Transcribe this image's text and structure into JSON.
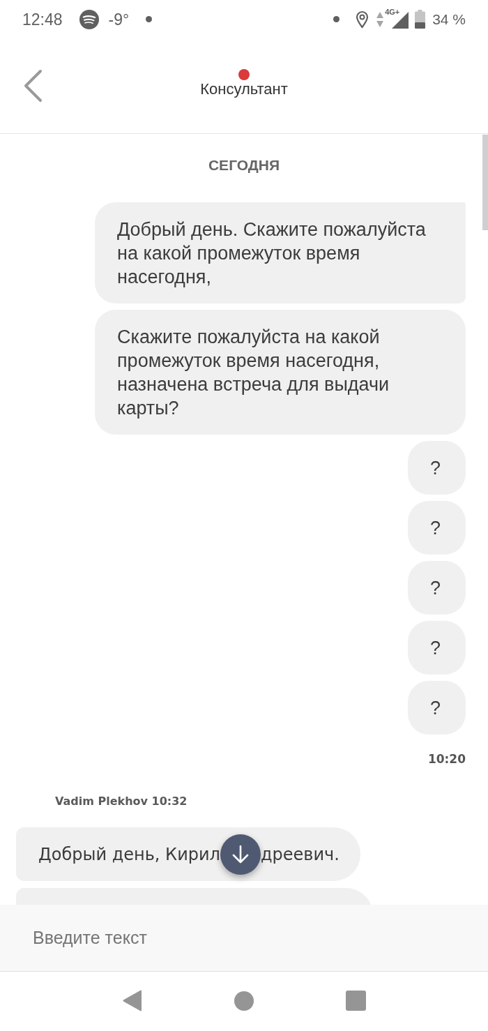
{
  "status_bar": {
    "time": "12:48",
    "temperature": "-9°",
    "network": "4G+",
    "battery": "34 %"
  },
  "header": {
    "title": "Консультант"
  },
  "chat": {
    "date_divider": "СЕГОДНЯ",
    "groups": [
      {
        "kind": "outgoing",
        "messages": [
          {
            "kind": "text",
            "text": "Добрый день. Скажите пожалуйста на какой промежуток время насегодня,"
          },
          {
            "kind": "text",
            "text": "Скажите пожалуйста на какой промежуток время насегодня, назначена встреча для выдачи карты?"
          },
          {
            "kind": "text",
            "text": "?"
          },
          {
            "kind": "text",
            "text": "?"
          },
          {
            "kind": "text",
            "text": "?"
          },
          {
            "kind": "text",
            "text": "?"
          },
          {
            "kind": "text",
            "text": "?"
          }
        ],
        "time": "10:20"
      },
      {
        "kind": "incoming",
        "sender": "Vadim Plekhov 10:32",
        "messages": [
          {
            "kind": "covered",
            "text_parts": [
              "Добрый день, Кирил",
              "дреевич."
            ]
          },
          {
            "kind": "cut"
          }
        ]
      }
    ]
  },
  "composer": {
    "placeholder": "Введите текст"
  }
}
